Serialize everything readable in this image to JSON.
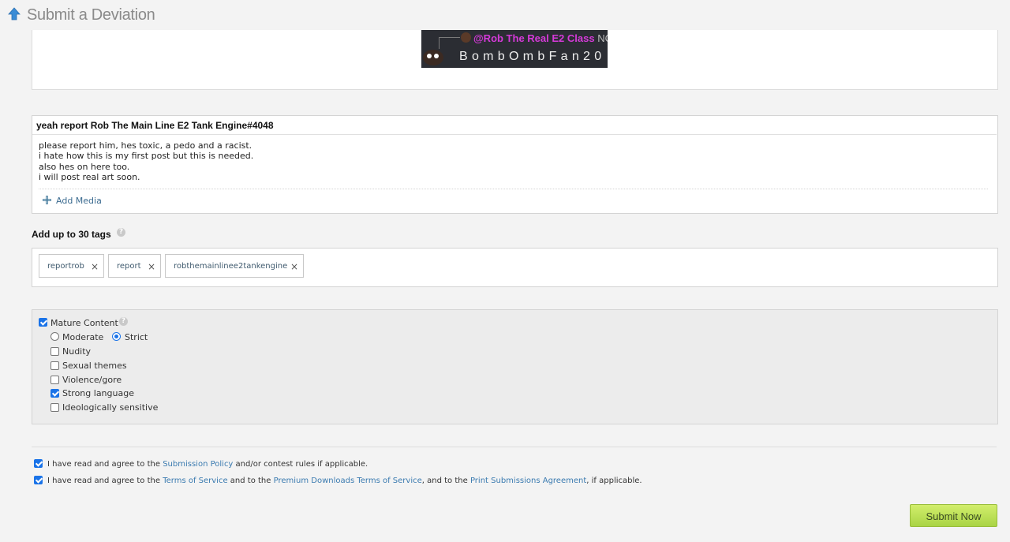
{
  "header": {
    "title": "Submit a Deviation",
    "icon": "up-arrow-icon",
    "icon_color": "#3a8cd6"
  },
  "preview": {
    "line1_name": "@Rob The Real E2 Class",
    "line1_suffix": "NO",
    "line2": "BombOmbFan20"
  },
  "post": {
    "title": "yeah report Rob The Main Line E2 Tank Engine#4048",
    "body_lines": [
      "please report him, hes toxic, a pedo and a racist.",
      "i hate how this is my first post but this is needed.",
      "also hes on here too.",
      "i will post real art soon."
    ],
    "add_media_label": "Add Media"
  },
  "tags": {
    "label": "Add up to 30 tags",
    "items": [
      {
        "text": "reportrob"
      },
      {
        "text": "report"
      },
      {
        "text": "robthemainlinee2tankengine"
      }
    ],
    "remove_glyph": "×"
  },
  "mature": {
    "label": "Mature Content",
    "checked": true,
    "levels": [
      {
        "label": "Moderate",
        "selected": false
      },
      {
        "label": "Strict",
        "selected": true
      }
    ],
    "options": [
      {
        "label": "Nudity",
        "checked": false
      },
      {
        "label": "Sexual themes",
        "checked": false
      },
      {
        "label": "Violence/gore",
        "checked": false
      },
      {
        "label": "Strong language",
        "checked": true
      },
      {
        "label": "Ideologically sensitive",
        "checked": false
      }
    ]
  },
  "agreements": {
    "line1": {
      "pre": "I have read and agree to the ",
      "link1": "Submission Policy",
      "post": " and/or contest rules if applicable."
    },
    "line2": {
      "pre": "I have read and agree to the ",
      "link1": "Terms of Service",
      "mid1": " and to the ",
      "link2": "Premium Downloads Terms of Service",
      "mid2": ", and to the ",
      "link3": "Print Submissions Agreement",
      "post": ", if applicable."
    }
  },
  "submit_label": "Submit Now",
  "colors": {
    "accent": "#1a73e8",
    "link": "#3b7bb0",
    "submit": "#b8dd55"
  }
}
